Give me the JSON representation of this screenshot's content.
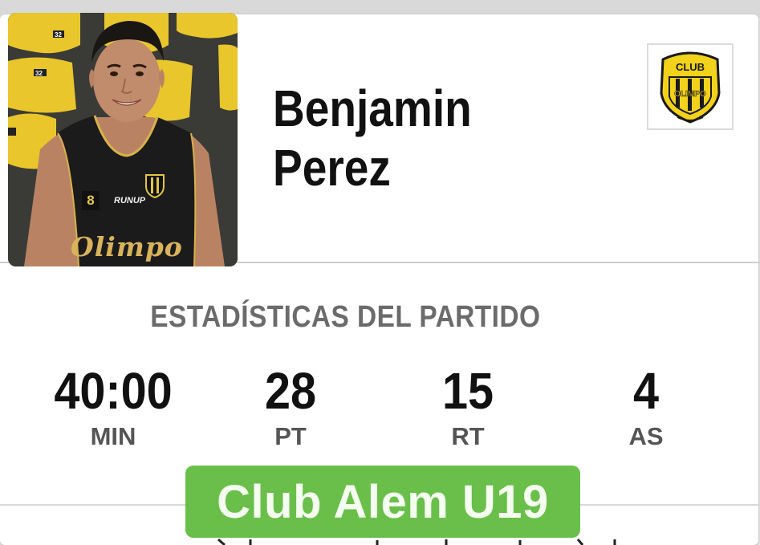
{
  "player": {
    "first_name": "Benjamin",
    "last_name": "Perez",
    "jersey_number": "8",
    "jersey_brand": "RUNUP",
    "jersey_team_script": "Olimpo"
  },
  "club": {
    "logo_text_top": "CLUB",
    "logo_text_main": "OLIMPO",
    "logo_color": "#f2d21b"
  },
  "stats": {
    "title": "ESTADÍSTICAS DEL PARTIDO",
    "items": [
      {
        "value": "40:00",
        "label": "MIN"
      },
      {
        "value": "28",
        "label": "PT"
      },
      {
        "value": "15",
        "label": "RT"
      },
      {
        "value": "4",
        "label": "AS"
      }
    ]
  },
  "opponent_badge": {
    "text": "Club Alem U19",
    "color": "#6abf4b"
  }
}
